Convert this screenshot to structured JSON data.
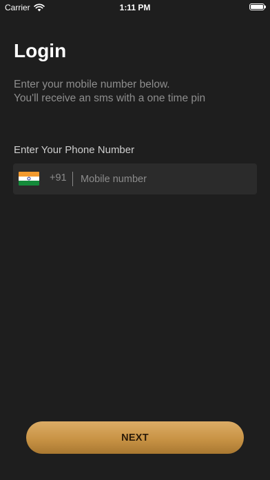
{
  "status_bar": {
    "carrier": "Carrier",
    "time": "1:11 PM"
  },
  "login": {
    "title": "Login",
    "subtitle_line1": "Enter your mobile number below.",
    "subtitle_line2": "You'll receive an sms with a one time pin",
    "phone_label": "Enter Your Phone Number",
    "country_code": "+91",
    "country_flag": "india-flag",
    "mobile_placeholder": "Mobile number",
    "mobile_value": "",
    "next_label": "NEXT"
  },
  "colors": {
    "background": "#1e1e1e",
    "input_background": "#2b2b2b",
    "button_gold": "#c89345",
    "muted_text": "#8e8e8e"
  }
}
